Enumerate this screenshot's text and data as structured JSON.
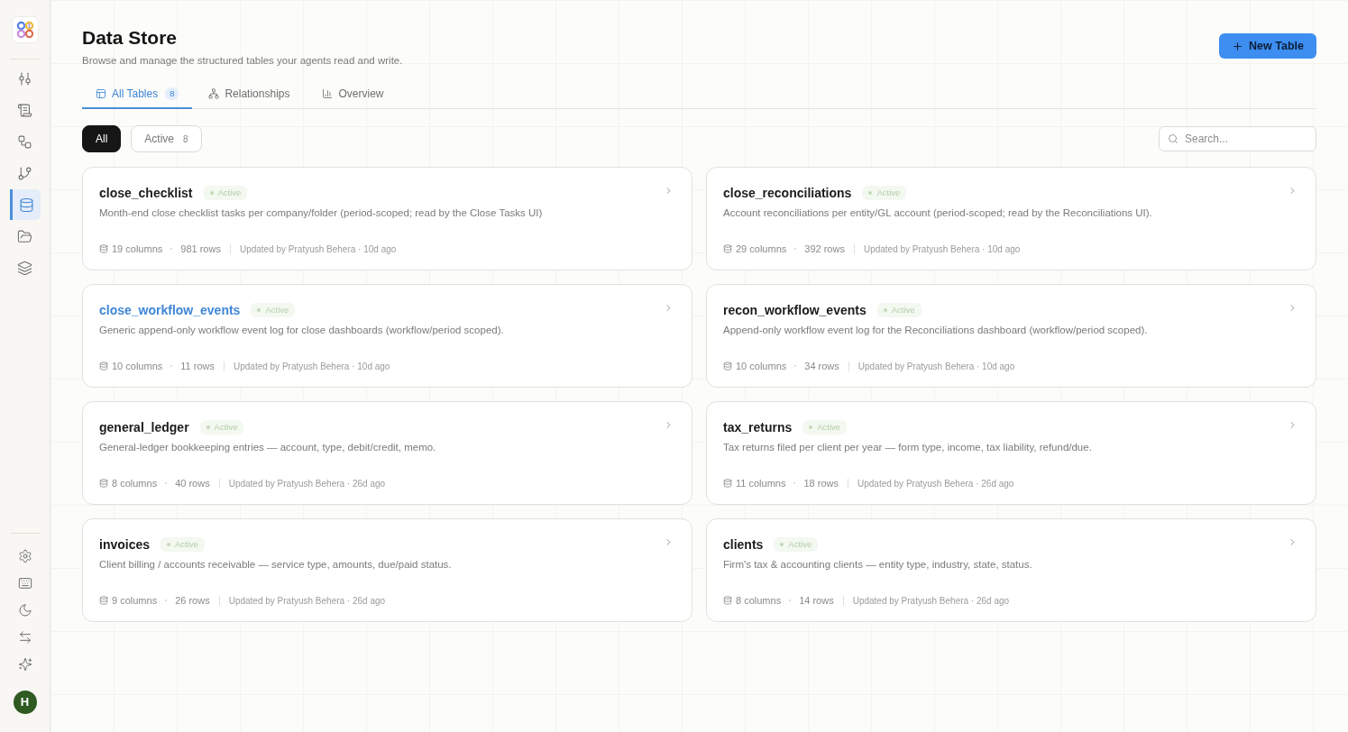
{
  "sidebar": {
    "nav": [
      {
        "selected": false
      },
      {
        "selected": false
      },
      {
        "selected": false
      },
      {
        "selected": false
      },
      {
        "selected": true
      },
      {
        "selected": false
      },
      {
        "selected": false
      }
    ],
    "user": {
      "initial": "H"
    }
  },
  "header": {
    "title": "Data Store",
    "subtitle": "Browse and manage the structured tables your agents read and write.",
    "new_button": {
      "label": "New Table"
    }
  },
  "tabs": [
    {
      "label": "All Tables",
      "count": "8",
      "selected": true
    },
    {
      "label": "Relationships",
      "selected": false
    },
    {
      "label": "Overview",
      "selected": false
    }
  ],
  "filters": [
    {
      "label": "All",
      "selected": true
    },
    {
      "label": "Active",
      "count": "8",
      "selected": false
    }
  ],
  "search": {
    "placeholder": "Search..."
  },
  "tables": [
    {
      "name": "close_checklist",
      "status": {
        "label": "Active",
        "kind": "active"
      },
      "description": "Month-end close checklist tasks per company/folder (period-scoped; read by the Close Tasks UI)",
      "columns": "19 columns",
      "rows": "981 rows",
      "updated": "Updated by Pratyush Behera · 10d ago",
      "hovered": false
    },
    {
      "name": "close_reconciliations",
      "status": {
        "label": "Active",
        "kind": "active"
      },
      "description": "Account reconciliations per entity/GL account (period-scoped; read by the Reconciliations UI).",
      "columns": "29 columns",
      "rows": "392 rows",
      "updated": "Updated by Pratyush Behera · 10d ago",
      "hovered": false
    },
    {
      "name": "close_workflow_events",
      "status": {
        "label": "Active",
        "kind": "active"
      },
      "description": "Generic append-only workflow event log for close dashboards (workflow/period scoped).",
      "columns": "10 columns",
      "rows": "11 rows",
      "updated": "Updated by Pratyush Behera · 10d ago",
      "hovered": true
    },
    {
      "name": "recon_workflow_events",
      "status": {
        "label": "Active",
        "kind": "active"
      },
      "description": "Append-only workflow event log for the Reconciliations dashboard (workflow/period scoped).",
      "columns": "10 columns",
      "rows": "34 rows",
      "updated": "Updated by Pratyush Behera · 10d ago",
      "hovered": false
    },
    {
      "name": "general_ledger",
      "status": {
        "label": "Active",
        "kind": "active"
      },
      "description": "General-ledger bookkeeping entries — account, type, debit/credit, memo.",
      "columns": "8 columns",
      "rows": "40 rows",
      "updated": "Updated by Pratyush Behera · 26d ago",
      "hovered": false
    },
    {
      "name": "tax_returns",
      "status": {
        "label": "Active",
        "kind": "active"
      },
      "description": "Tax returns filed per client per year — form type, income, tax liability, refund/due.",
      "columns": "11 columns",
      "rows": "18 rows",
      "updated": "Updated by Pratyush Behera · 26d ago",
      "hovered": false
    },
    {
      "name": "invoices",
      "status": {
        "label": "Active",
        "kind": "active"
      },
      "description": "Client billing / accounts receivable — service type, amounts, due/paid status.",
      "columns": "9 columns",
      "rows": "26 rows",
      "updated": "Updated by Pratyush Behera · 26d ago",
      "hovered": false
    },
    {
      "name": "clients",
      "status": {
        "label": "Active",
        "kind": "active"
      },
      "description": "Firm's tax & accounting clients — entity type, industry, state, status.",
      "columns": "8 columns",
      "rows": "14 rows",
      "updated": "Updated by Pratyush Behera · 26d ago",
      "hovered": false
    }
  ]
}
